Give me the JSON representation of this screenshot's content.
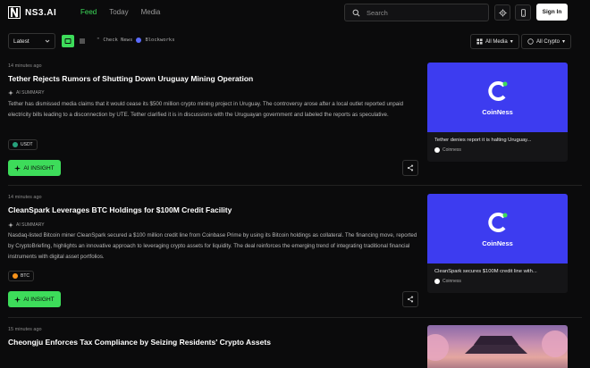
{
  "header": {
    "logo": "NS3.AI",
    "nav": [
      {
        "label": "Feed",
        "active": true
      },
      {
        "label": "Today",
        "active": false
      },
      {
        "label": "Media",
        "active": false
      }
    ],
    "search_placeholder": "Search",
    "signin_label": "Sign In"
  },
  "toolbar": {
    "sort_value": "Latest",
    "marquee_prefix": "Check News",
    "marquee_source": "Blockworks",
    "filter_media": "All Media",
    "filter_crypto": "All Crypto"
  },
  "articles": [
    {
      "time": "14 minutes ago",
      "title": "Tether Rejects Rumors of Shutting Down Uruguay Mining Operation",
      "summary_label": "AI SUMMARY",
      "summary": "Tether has dismissed media claims that it would cease its $500 million crypto mining project in Uruguay. The controversy arose after a local outlet reported unpaid electricity bills leading to a disconnection by UTE. Tether clarified it is in discussions with the Uruguayan government and labeled the reports as speculative.",
      "tag": "USDT",
      "insight_label": "AI INSIGHT",
      "card_title": "Tether denies report it is halting Uruguay...",
      "card_source": "Coinness",
      "card_brand": "CoinNess"
    },
    {
      "time": "14 minutes ago",
      "title": "CleanSpark Leverages BTC Holdings for $100M Credit Facility",
      "summary_label": "AI SUMMARY",
      "summary": "Nasdaq-listed Bitcoin miner CleanSpark secured a $100 million credit line from Coinbase Prime by using its Bitcoin holdings as collateral. The financing move, reported by CryptoBriefing, highlights an innovative approach to leveraging crypto assets for liquidity. The deal reinforces the emerging trend of integrating traditional financial instruments with digital asset portfolios.",
      "tag": "BTC",
      "insight_label": "AI INSIGHT",
      "card_title": "CleanSpark secures $100M credit line with...",
      "card_source": "Coinness",
      "card_brand": "CoinNess"
    },
    {
      "time": "15 minutes ago",
      "title": "Cheongju Enforces Tax Compliance by Seizing Residents' Crypto Assets"
    }
  ],
  "colors": {
    "accent": "#3ddc5a",
    "card_blue": "#3d3cf0",
    "background": "#0b0b0c"
  }
}
